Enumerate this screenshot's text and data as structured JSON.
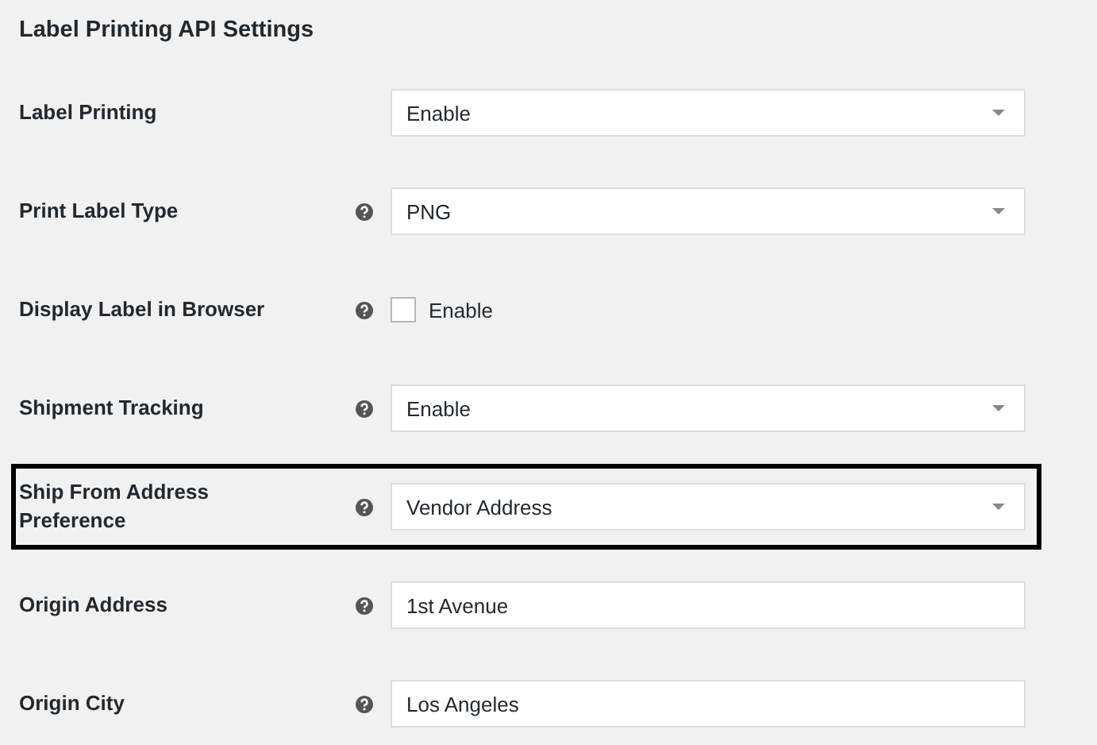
{
  "title": "Label Printing API Settings",
  "rows": [
    {
      "label": "Label Printing",
      "help": false,
      "kind": "select",
      "value": "Enable",
      "highlighted": false
    },
    {
      "label": "Print Label Type",
      "help": true,
      "kind": "select",
      "value": "PNG",
      "highlighted": false
    },
    {
      "label": "Display Label in Browser",
      "help": true,
      "kind": "checkbox",
      "value": "Enable",
      "checked": false,
      "highlighted": false
    },
    {
      "label": "Shipment Tracking",
      "help": true,
      "kind": "select",
      "value": "Enable",
      "highlighted": false
    },
    {
      "label": "Ship From Address Preference",
      "help": true,
      "kind": "select",
      "value": "Vendor Address",
      "highlighted": true
    },
    {
      "label": "Origin Address",
      "help": true,
      "kind": "text",
      "value": "1st Avenue",
      "highlighted": false
    },
    {
      "label": "Origin City",
      "help": true,
      "kind": "text",
      "value": "Los Angeles",
      "highlighted": false
    }
  ]
}
